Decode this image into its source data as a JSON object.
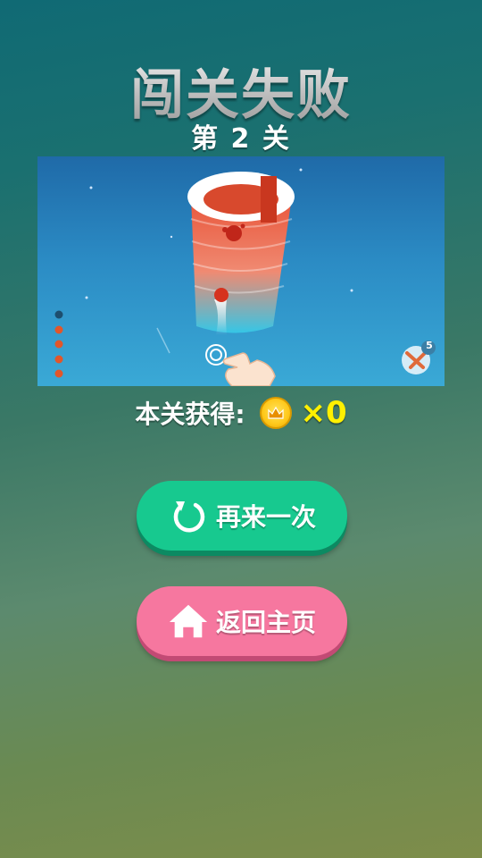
{
  "header": {
    "title": "闯关失败",
    "level_text": "第 2 关"
  },
  "preview": {
    "booster_count": "5",
    "balls_remaining": 5
  },
  "reward": {
    "label": "本关获得:",
    "coin_count": "×0"
  },
  "buttons": {
    "retry_label": "再来一次",
    "home_label": "返回主页"
  },
  "colors": {
    "retry": "#17c98f",
    "home": "#f6779f",
    "coin_text": "#fff000"
  }
}
